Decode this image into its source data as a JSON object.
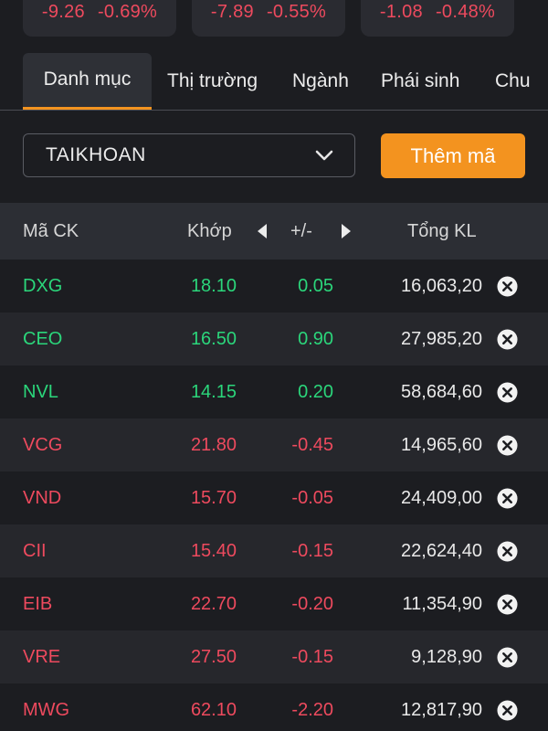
{
  "indices": [
    {
      "change": "-9.26",
      "percent": "-0.69%"
    },
    {
      "change": "-7.89",
      "percent": "-0.55%"
    },
    {
      "change": "-1.08",
      "percent": "-0.48%"
    }
  ],
  "tabs": [
    {
      "label": "Danh mục",
      "active": true
    },
    {
      "label": "Thị trường",
      "active": false
    },
    {
      "label": "Ngành",
      "active": false
    },
    {
      "label": "Phái sinh",
      "active": false
    },
    {
      "label": "Chu",
      "active": false
    }
  ],
  "watchlist": {
    "selected": "TAIKHOAN",
    "add_label": "Thêm mã"
  },
  "table": {
    "headers": {
      "symbol": "Mã CK",
      "price": "Khớp",
      "change": "+/-",
      "volume": "Tổng KL"
    },
    "rows": [
      {
        "symbol": "DXG",
        "price": "18.10",
        "change": "0.05",
        "volume": "16,063,20",
        "trend": "up"
      },
      {
        "symbol": "CEO",
        "price": "16.50",
        "change": "0.90",
        "volume": "27,985,20",
        "trend": "up"
      },
      {
        "symbol": "NVL",
        "price": "14.15",
        "change": "0.20",
        "volume": "58,684,60",
        "trend": "up"
      },
      {
        "symbol": "VCG",
        "price": "21.80",
        "change": "-0.45",
        "volume": "14,965,60",
        "trend": "down"
      },
      {
        "symbol": "VND",
        "price": "15.70",
        "change": "-0.05",
        "volume": "24,409,00",
        "trend": "down"
      },
      {
        "symbol": "CII",
        "price": "15.40",
        "change": "-0.15",
        "volume": "22,624,40",
        "trend": "down"
      },
      {
        "symbol": "EIB",
        "price": "22.70",
        "change": "-0.20",
        "volume": "11,354,90",
        "trend": "down"
      },
      {
        "symbol": "VRE",
        "price": "27.50",
        "change": "-0.15",
        "volume": "9,128,90",
        "trend": "down"
      },
      {
        "symbol": "MWG",
        "price": "62.10",
        "change": "-2.20",
        "volume": "12,817,90",
        "trend": "down"
      }
    ]
  },
  "colors": {
    "accent": "#f3931f",
    "up": "#2bd67b",
    "down": "#ee4a5e",
    "background": "#1c1d21"
  },
  "icons": {
    "dropdown": "chevron-down-icon",
    "prev": "triangle-left-icon",
    "next": "triangle-right-icon",
    "remove": "close-circle-icon"
  }
}
